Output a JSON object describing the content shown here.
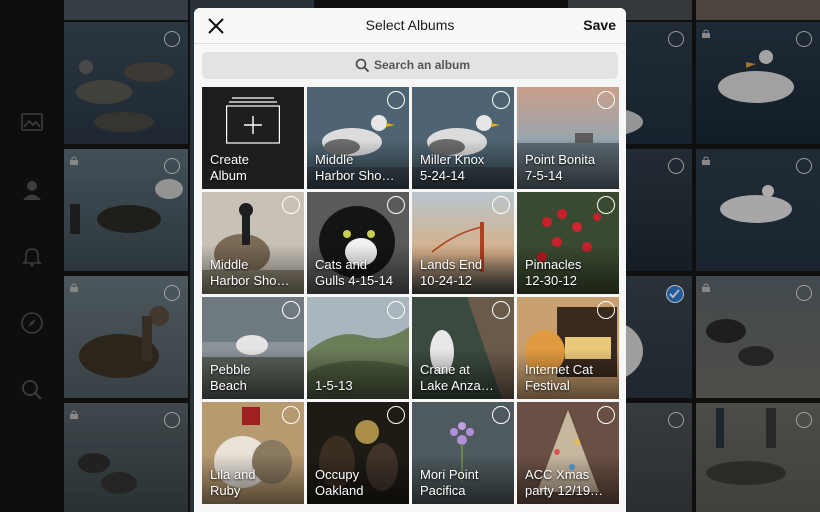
{
  "sidebar": {
    "icons": [
      "photos-icon",
      "profile-icon",
      "bell-icon",
      "compass-icon",
      "search-icon"
    ]
  },
  "modal": {
    "title": "Select Albums",
    "save_label": "Save",
    "search_placeholder": "Search an album",
    "create_label": "Create\nAlbum",
    "albums": [
      {
        "label": "Middle\nHarbor Sho…"
      },
      {
        "label": "Miller Knox\n5-24-14"
      },
      {
        "label": "Point Bonita\n7-5-14"
      },
      {
        "label": "Middle\nHarbor Sho…"
      },
      {
        "label": "Cats and\nGulls 4-15-14"
      },
      {
        "label": "Lands End\n10-24-12"
      },
      {
        "label": "Pinnacles\n12-30-12"
      },
      {
        "label": "Pebble\nBeach"
      },
      {
        "label": "1-5-13"
      },
      {
        "label": "Crane at\nLake Anza…"
      },
      {
        "label": "Internet Cat\nFestival"
      },
      {
        "label": "Lila and\nRuby"
      },
      {
        "label": "Occupy\nOakland"
      },
      {
        "label": "Mori Point\nPacifica"
      },
      {
        "label": "ACC Xmas\nparty 12/19…"
      }
    ],
    "tile_background": "#1e1e1e"
  },
  "colors": {
    "check_blue": "#2f7fd8",
    "header_bg": "#f8f8f8",
    "search_bg": "#e3e3e3"
  }
}
